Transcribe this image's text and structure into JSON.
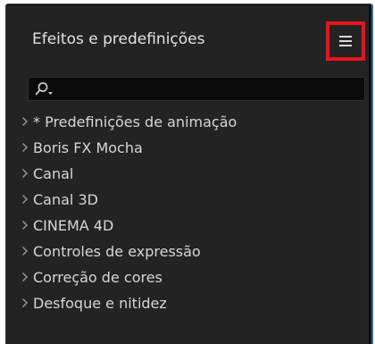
{
  "panel": {
    "title": "Efeitos e predefinições",
    "menu_icon": "hamburger-menu-icon",
    "highlight_color": "#e8141c"
  },
  "search": {
    "value": "",
    "placeholder": "",
    "icon": "search-icon-with-dropdown"
  },
  "categories": [
    {
      "label": "* Predefinições de animação",
      "icon": "chevron-right-icon"
    },
    {
      "label": "Boris FX Mocha",
      "icon": "chevron-right-icon"
    },
    {
      "label": "Canal",
      "icon": "chevron-right-icon"
    },
    {
      "label": "Canal 3D",
      "icon": "chevron-right-icon"
    },
    {
      "label": "CINEMA 4D",
      "icon": "chevron-right-icon"
    },
    {
      "label": "Controles de expressão",
      "icon": "chevron-right-icon"
    },
    {
      "label": "Correção de cores",
      "icon": "chevron-right-icon"
    },
    {
      "label": "Desfoque e nitidez",
      "icon": "chevron-right-icon"
    }
  ]
}
